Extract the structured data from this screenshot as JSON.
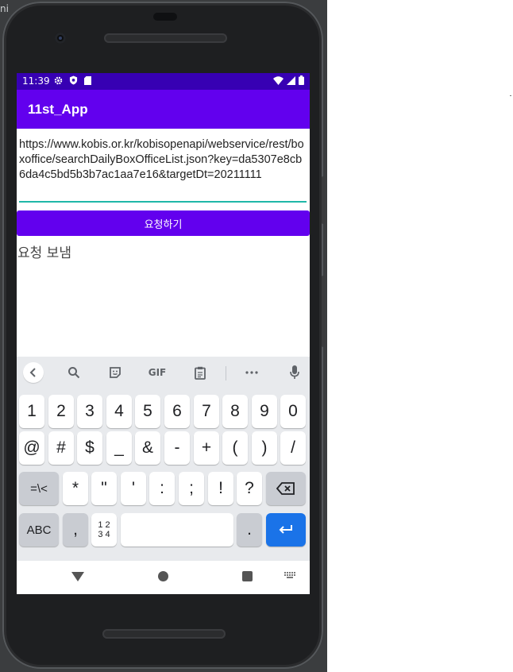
{
  "desktop": {
    "fragment_text": "ni"
  },
  "status_bar": {
    "time": "11:39",
    "left_icons": [
      "gear-icon",
      "shield-icon",
      "sd-card-icon"
    ],
    "right_icons": [
      "wifi-icon",
      "signal-icon",
      "battery-icon"
    ]
  },
  "app_bar": {
    "title": "11st_App"
  },
  "url_input": {
    "value": "https://www.kobis.or.kr/kobisopenapi/webservice/rest/boxoffice/searchDailyBoxOfficeList.json?key=da5307e8cb6da4c5bd5b3b7ac1aa7e16&targetDt=20211111"
  },
  "request_button": {
    "label": "요청하기"
  },
  "result_text": "요청 보냄",
  "keyboard": {
    "toolbar": [
      "back-icon",
      "search-icon",
      "sticker-icon",
      "GIF",
      "clipboard-icon",
      "more-icon",
      "microphone-icon"
    ],
    "row1": [
      "1",
      "2",
      "3",
      "4",
      "5",
      "6",
      "7",
      "8",
      "9",
      "0"
    ],
    "row2": [
      "@",
      "#",
      "$",
      "_",
      "&",
      "-",
      "+",
      "(",
      ")",
      "/"
    ],
    "row3": [
      "=\\<",
      "*",
      "\"",
      "'",
      ":",
      ";",
      "!",
      "?"
    ],
    "row4": {
      "abc": "ABC",
      "comma": ",",
      "numpad_top": "1 2",
      "numpad_bottom": "3 4",
      "period": "."
    },
    "colors": {
      "background": "#e8eaed",
      "key": "#ffffff",
      "function_key": "#c9ccd2",
      "enter": "#1a73e8"
    }
  },
  "colors": {
    "primary": "#6200ee",
    "primary_dark": "#3700b3",
    "underline": "#1fb7a8"
  }
}
